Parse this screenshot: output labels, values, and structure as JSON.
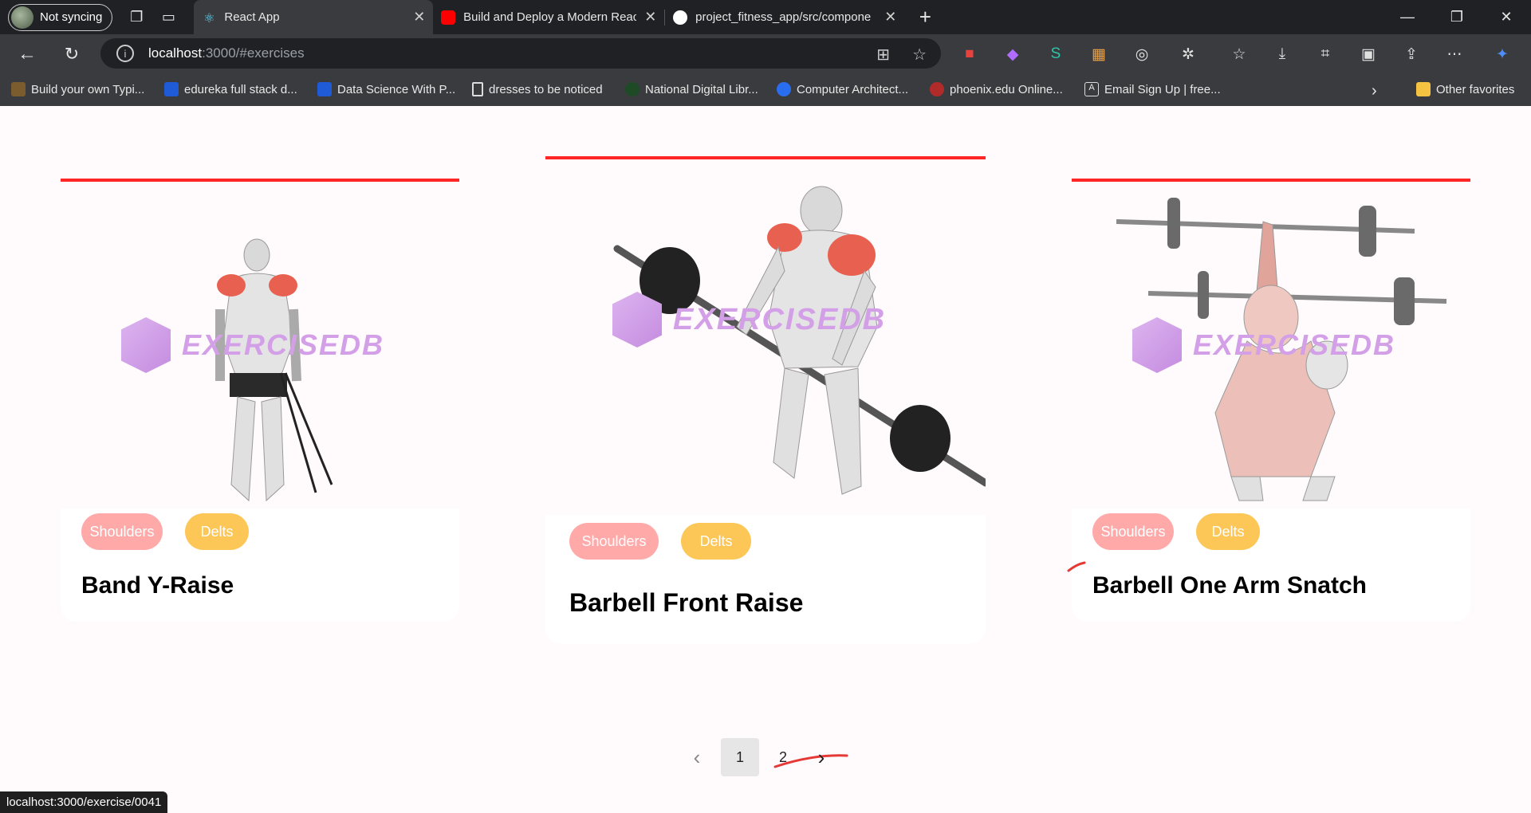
{
  "browser": {
    "profile_label": "Not syncing",
    "tabs": [
      {
        "title": "React App",
        "active": true
      },
      {
        "title": "Build and Deploy a Modern React",
        "active": false
      },
      {
        "title": "project_fitness_app/src/compone",
        "active": false
      }
    ],
    "address": {
      "host": "localhost",
      "path": ":3000/#exercises"
    },
    "bookmarks": [
      "Build your own Typi...",
      "edureka full stack d...",
      "Data Science With P...",
      "dresses to be noticed",
      "National Digital Libr...",
      "Computer Architect...",
      "phoenix.edu Online...",
      "Email Sign Up | free..."
    ],
    "other_favorites": "Other favorites",
    "status_url": "localhost:3000/exercise/0041"
  },
  "watermark": "EXERCISEDB",
  "exercises": [
    {
      "name": "Band Y-Raise",
      "body_part": "Shoulders",
      "target": "Delts"
    },
    {
      "name": "Barbell Front Raise",
      "body_part": "Shoulders",
      "target": "Delts"
    },
    {
      "name": "Barbell One Arm Snatch",
      "body_part": "Shoulders",
      "target": "Delts"
    }
  ],
  "pagination": {
    "pages": [
      "1",
      "2"
    ],
    "current": "1",
    "prev": "‹",
    "next": "›"
  },
  "colors": {
    "accent": "#ff2625",
    "chip_body": "#ffa9a9",
    "chip_target": "#fcc757",
    "watermark": "#d3a0e8"
  }
}
